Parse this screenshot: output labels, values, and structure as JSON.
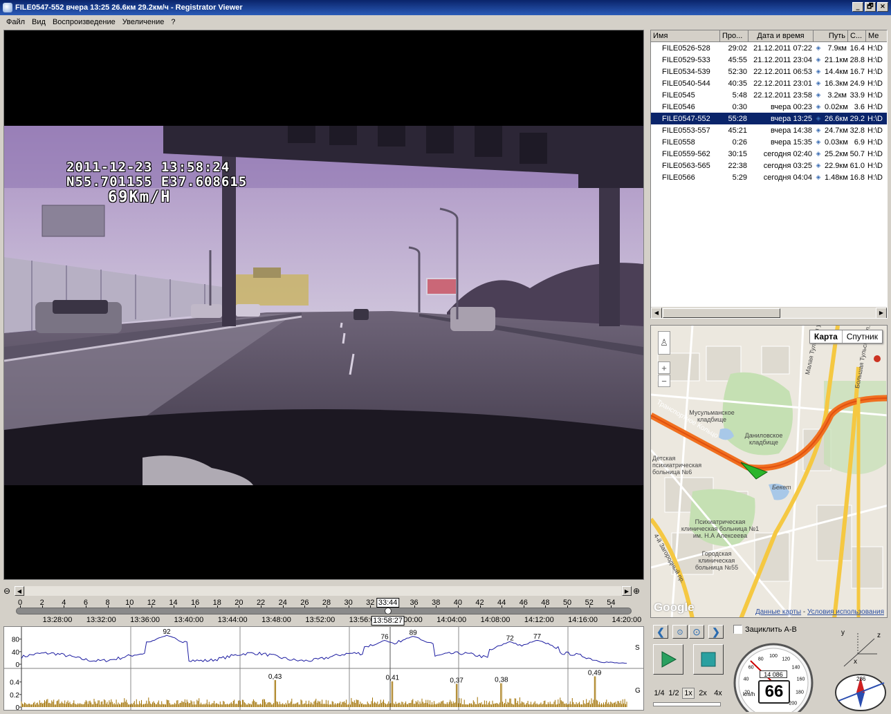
{
  "window": {
    "title": "FILE0547-552    вчера 13:25    26.6км    29.2км/ч - Registrator Viewer",
    "controls": [
      "_",
      "🗗",
      "×"
    ]
  },
  "menu": [
    "Файл",
    "Вид",
    "Воспроизведение",
    "Увеличение",
    "?"
  ],
  "osd": {
    "line1": "2011-12-23  13:58:24",
    "line2": "N55.701155  E37.608615",
    "line3": "69Km/H"
  },
  "file_list": {
    "headers": [
      "Имя",
      "Про...",
      "Дата и время",
      "Путь",
      "С...",
      "Ме"
    ],
    "rows": [
      {
        "name": "FILE0526-528",
        "duration": "29:02",
        "date": "21.12.2011 07:22",
        "path": "7.9км",
        "speed": "16.4",
        "location": "H:\\D"
      },
      {
        "name": "FILE0529-533",
        "duration": "45:55",
        "date": "21.12.2011 23:04",
        "path": "21.1км",
        "speed": "28.8",
        "location": "H:\\D"
      },
      {
        "name": "FILE0534-539",
        "duration": "52:30",
        "date": "22.12.2011 06:53",
        "path": "14.4км",
        "speed": "16.7",
        "location": "H:\\D"
      },
      {
        "name": "FILE0540-544",
        "duration": "40:35",
        "date": "22.12.2011 23:01",
        "path": "16.3км",
        "speed": "24.9",
        "location": "H:\\D"
      },
      {
        "name": "FILE0545",
        "duration": "5:48",
        "date": "22.12.2011 23:58",
        "path": "3.2км",
        "speed": "33.9",
        "location": "H:\\D"
      },
      {
        "name": "FILE0546",
        "duration": "0:30",
        "date": "вчера 00:23",
        "path": "0.02км",
        "speed": "3.6",
        "location": "H:\\D"
      },
      {
        "name": "FILE0547-552",
        "duration": "55:28",
        "date": "вчера 13:25",
        "path": "26.6км",
        "speed": "29.2",
        "location": "H:\\D",
        "selected": true
      },
      {
        "name": "FILE0553-557",
        "duration": "45:21",
        "date": "вчера 14:38",
        "path": "24.7км",
        "speed": "32.8",
        "location": "H:\\D"
      },
      {
        "name": "FILE0558",
        "duration": "0:26",
        "date": "вчера 15:35",
        "path": "0.03км",
        "speed": "6.9",
        "location": "H:\\D"
      },
      {
        "name": "FILE0559-562",
        "duration": "30:15",
        "date": "сегодня 02:40",
        "path": "25.2км",
        "speed": "50.7",
        "location": "H:\\D"
      },
      {
        "name": "FILE0563-565",
        "duration": "22:38",
        "date": "сегодня 03:25",
        "path": "22.9км",
        "speed": "61.0",
        "location": "H:\\D"
      },
      {
        "name": "FILE0566",
        "duration": "5:29",
        "date": "сегодня 04:04",
        "path": "1.48км",
        "speed": "16.8",
        "location": "H:\\D"
      }
    ]
  },
  "map": {
    "type_map": "Карта",
    "type_satellite": "Спутник",
    "labels": {
      "ring": "Транспортное Кольцо",
      "muslim": "Мусульманское кладбище",
      "danilov": "Даниловское кладбище",
      "child_hosp": "Детская психиатрическая больница №6",
      "psych": "Психиатрическая клиническая больница №1 им. Н.А Алексеева",
      "city_hosp": "Городская клиническая больница №55",
      "beket": "Бекет",
      "tulskaya_small": "Малая Тульская ул.",
      "tulskaya_big": "Большая Тульская ул.",
      "zagorod": "4-й Загородный пр."
    },
    "logo": "Google",
    "footer_data": "Данные карты",
    "footer_sep": " - ",
    "footer_terms": "Условия использования"
  },
  "scrub": {
    "minute_ticks": [
      "0",
      "2",
      "4",
      "6",
      "8",
      "10",
      "12",
      "14",
      "16",
      "18",
      "20",
      "22",
      "24",
      "26",
      "28",
      "30",
      "32",
      "34",
      "36",
      "38",
      "40",
      "42",
      "44",
      "46",
      "48",
      "50",
      "52",
      "54"
    ],
    "current_minute_label": "33:44",
    "clock_ticks": [
      "13:28:00",
      "13:32:00",
      "13:36:00",
      "13:40:00",
      "13:44:00",
      "13:48:00",
      "13:52:00",
      "13:56:00",
      "14:00:00",
      "14:04:00",
      "14:08:00",
      "14:12:00",
      "14:16:00",
      "14:20:00"
    ],
    "current_clock_label": "13:58:27",
    "position": 0.6
  },
  "chart_data": [
    {
      "type": "line",
      "name": "S",
      "ylim": [
        0,
        110
      ],
      "yticks": [
        "80",
        "40",
        "0"
      ],
      "annotations": [
        {
          "x": 0.24,
          "y": 92,
          "label": "92"
        },
        {
          "x": 0.6,
          "y": 76,
          "label": "76"
        },
        {
          "x": 0.647,
          "y": 89,
          "label": "89"
        },
        {
          "x": 0.807,
          "y": 72,
          "label": "72"
        },
        {
          "x": 0.852,
          "y": 77,
          "label": "77"
        }
      ]
    },
    {
      "type": "bar",
      "name": "G",
      "ylim": [
        0,
        0.55
      ],
      "yticks": [
        "0.4",
        "0.2",
        "0"
      ],
      "annotations": [
        {
          "x": 0.419,
          "y": 0.43,
          "label": "0,43"
        },
        {
          "x": 0.613,
          "y": 0.41,
          "label": "0,41"
        },
        {
          "x": 0.719,
          "y": 0.37,
          "label": "0,37"
        },
        {
          "x": 0.793,
          "y": 0.38,
          "label": "0,38"
        },
        {
          "x": 0.947,
          "y": 0.49,
          "label": "0,49"
        }
      ]
    }
  ],
  "controls": {
    "loop_label": "Зациклить А-В",
    "speeds": [
      "1/4",
      "1/2",
      "1x",
      "2x",
      "4x"
    ],
    "odometer": "14 086",
    "speed_value": "66",
    "speed_unit": "km/h",
    "gauge_ticks": [
      "20",
      "40",
      "60",
      "80",
      "100",
      "120",
      "140",
      "160",
      "180",
      "200"
    ],
    "heading": "286",
    "axes": [
      "y",
      "z",
      "x"
    ]
  },
  "colors": {
    "selection": "#0a246a",
    "speed_line": "#1a1aa0",
    "g_bars": "#a07000",
    "route": "#f07020",
    "title_gradient": "#0a246a"
  }
}
